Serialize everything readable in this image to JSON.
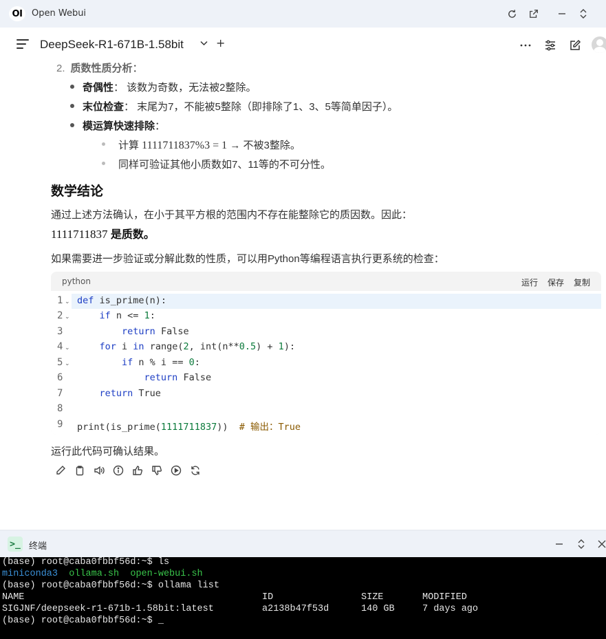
{
  "window": {
    "logo": "OI",
    "title": "Open Webui",
    "icons": [
      "refresh-icon",
      "external-link-icon",
      "minimize-icon",
      "restore-icon"
    ]
  },
  "header": {
    "model": "DeepSeek-R1-671B-1.58bit",
    "chevron": "⌄",
    "add": "+"
  },
  "response": {
    "ol_num": "2.",
    "ol_title": "质数性质分析",
    "ol_suffix": "：",
    "bullets": [
      {
        "label": "奇偶性",
        "text": "： 该数为奇数，无法被2整除。"
      },
      {
        "label": "末位检查",
        "text": "： 末尾为7，不能被5整除（即排除了1、3、5等简单因子）。"
      },
      {
        "label": "模运算快速排除",
        "text": "："
      }
    ],
    "sub_bullets": [
      {
        "prefix": "计算 ",
        "math": "1111711837%3 = 1",
        "suffix": " → 不被3整除。"
      },
      {
        "prefix": "同样可验证其他小质数如7、11等的不可分性。",
        "math": "",
        "suffix": ""
      }
    ],
    "heading": "数学结论",
    "para1": "通过上述方法确认，在小于其平方根的范围内不存在能整除它的质因数。因此：",
    "conclusion_math": "1111711837",
    "conclusion_text": " 是质数。",
    "para2": "如果需要进一步验证或分解此数的性质，可以用Python等编程语言执行更系统的检查：",
    "after_code": "运行此代码可确认结果。"
  },
  "code": {
    "lang": "python",
    "run": "运行",
    "save": "保存",
    "copy": "复制",
    "lines": [
      {
        "n": "1",
        "fold": true
      },
      {
        "n": "2",
        "fold": true
      },
      {
        "n": "3",
        "fold": false
      },
      {
        "n": "4",
        "fold": true
      },
      {
        "n": "5",
        "fold": true
      },
      {
        "n": "6",
        "fold": false
      },
      {
        "n": "7",
        "fold": false
      },
      {
        "n": "8",
        "fold": false
      },
      {
        "n": "9",
        "fold": false
      }
    ]
  },
  "actions": [
    "edit-icon",
    "copy-icon",
    "read-aloud-icon",
    "info-icon",
    "thumbs-up-icon",
    "thumbs-down-icon",
    "continue-icon",
    "regenerate-icon"
  ],
  "terminal": {
    "title": "终端",
    "logo": ">_",
    "prompt": "(base) root@caba0fbbf56d:~$ ",
    "cmd1": "ls",
    "ls_items": [
      "miniconda3",
      "ollama.sh",
      "open-webui.sh"
    ],
    "cmd2": "ollama list",
    "table_header": [
      "NAME",
      "ID",
      "SIZE",
      "MODIFIED"
    ],
    "table_row": [
      "SIGJNF/deepseek-r1-671b-1.58bit:latest",
      "a2138b47f53d",
      "140 GB",
      "7 days ago"
    ],
    "cursor": "_"
  }
}
